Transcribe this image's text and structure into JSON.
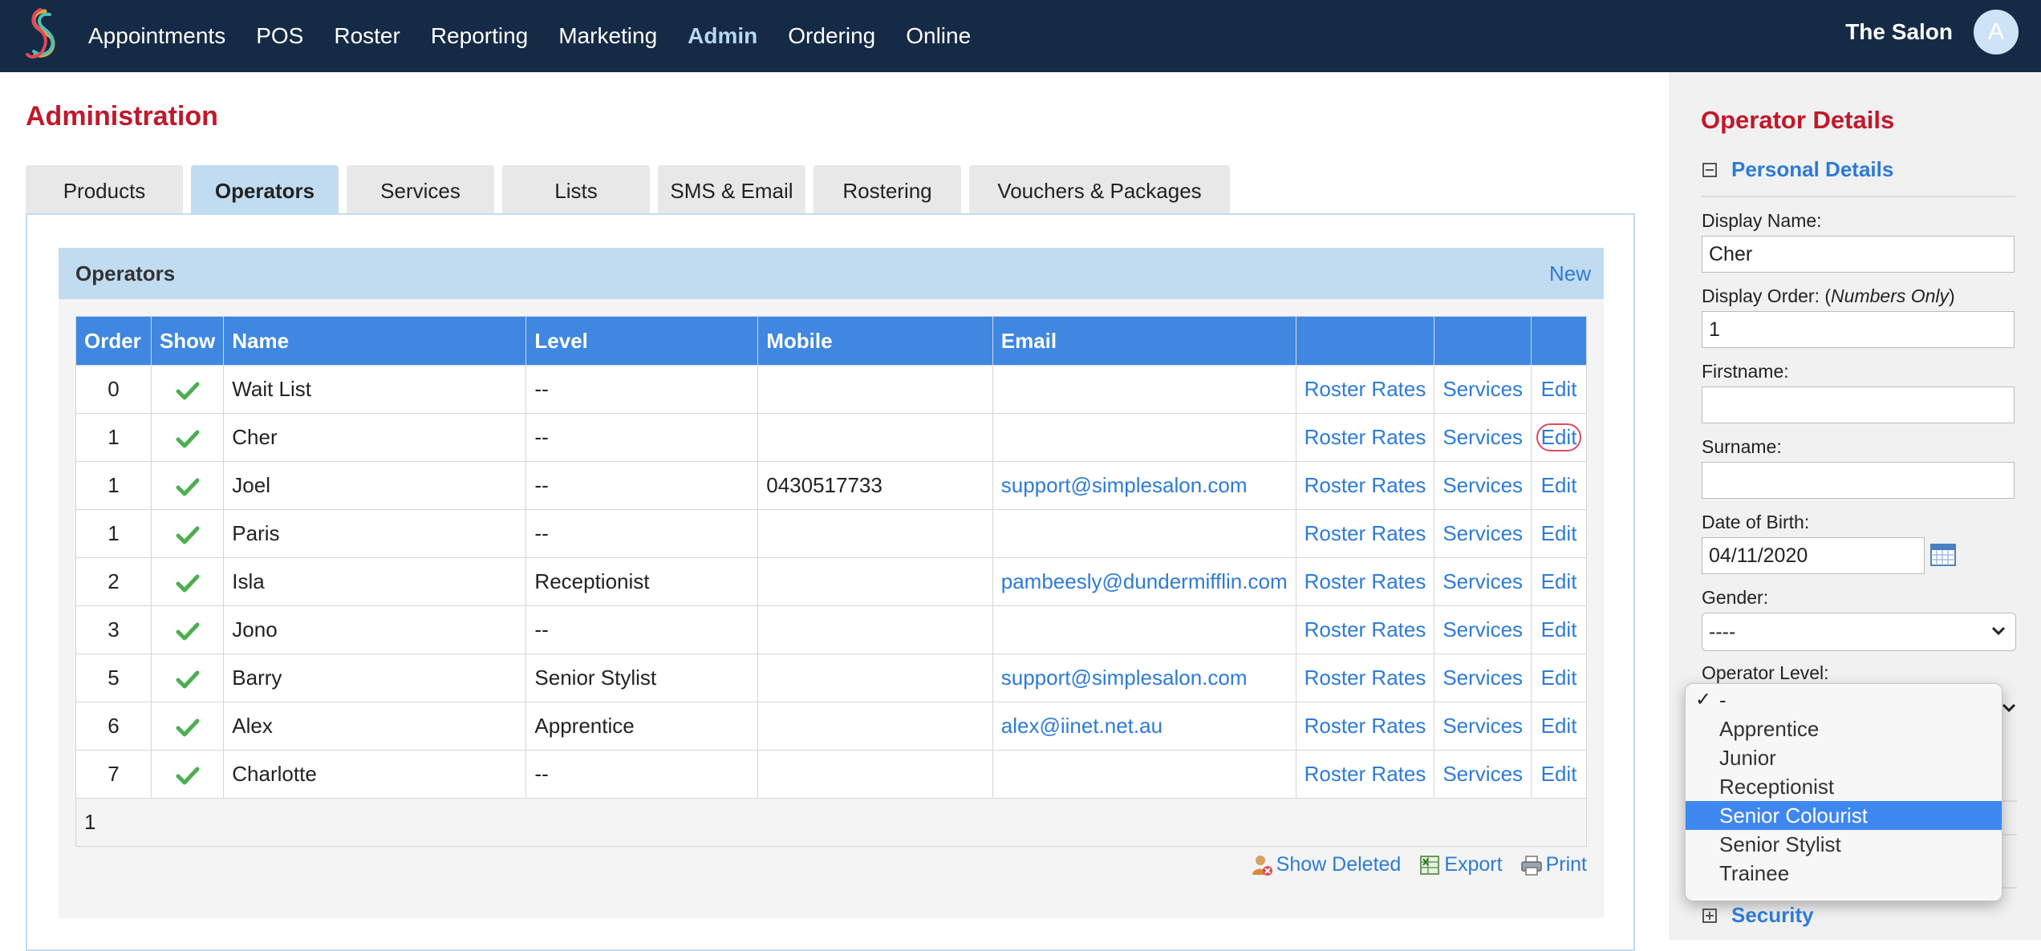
{
  "nav": {
    "items": [
      "Appointments",
      "POS",
      "Roster",
      "Reporting",
      "Marketing",
      "Admin",
      "Ordering",
      "Online"
    ],
    "active": "Admin",
    "salon_name": "The Salon",
    "avatar_letter": "A"
  },
  "page": {
    "title": "Administration",
    "tabs": [
      "Products",
      "Operators",
      "Services",
      "Lists",
      "SMS & Email",
      "Rostering",
      "Vouchers & Packages"
    ],
    "active_tab": "Operators"
  },
  "operators": {
    "section_title": "Operators",
    "new_label": "New",
    "columns": [
      "Order",
      "Show",
      "Name",
      "Level",
      "Mobile",
      "Email",
      "",
      "",
      ""
    ],
    "rows": [
      {
        "order": "0",
        "show": true,
        "name": "Wait List",
        "level": "--",
        "mobile": "",
        "email": "",
        "roster": "Roster Rates",
        "services": "Services",
        "edit": "Edit"
      },
      {
        "order": "1",
        "show": true,
        "name": "Cher",
        "level": "--",
        "mobile": "",
        "email": "",
        "roster": "Roster Rates",
        "services": "Services",
        "edit": "Edit"
      },
      {
        "order": "1",
        "show": true,
        "name": "Joel",
        "level": "--",
        "mobile": "0430517733",
        "email": "support@simplesalon.com",
        "roster": "Roster Rates",
        "services": "Services",
        "edit": "Edit"
      },
      {
        "order": "1",
        "show": true,
        "name": "Paris",
        "level": "--",
        "mobile": "",
        "email": "",
        "roster": "Roster Rates",
        "services": "Services",
        "edit": "Edit"
      },
      {
        "order": "2",
        "show": true,
        "name": "Isla",
        "level": "Receptionist",
        "mobile": "",
        "email": "pambeesly@dundermifflin.com",
        "roster": "Roster Rates",
        "services": "Services",
        "edit": "Edit"
      },
      {
        "order": "3",
        "show": true,
        "name": "Jono",
        "level": "--",
        "mobile": "",
        "email": "",
        "roster": "Roster Rates",
        "services": "Services",
        "edit": "Edit"
      },
      {
        "order": "5",
        "show": true,
        "name": "Barry",
        "level": "Senior Stylist",
        "mobile": "",
        "email": "support@simplesalon.com",
        "roster": "Roster Rates",
        "services": "Services",
        "edit": "Edit"
      },
      {
        "order": "6",
        "show": true,
        "name": "Alex",
        "level": "Apprentice",
        "mobile": "",
        "email": "alex@iinet.net.au",
        "roster": "Roster Rates",
        "services": "Services",
        "edit": "Edit"
      },
      {
        "order": "7",
        "show": true,
        "name": "Charlotte",
        "level": "--",
        "mobile": "",
        "email": "",
        "roster": "Roster Rates",
        "services": "Services",
        "edit": "Edit"
      }
    ],
    "highlighted_edit_row": 1,
    "pager": "1",
    "actions": {
      "show_deleted": "Show Deleted",
      "export": "Export",
      "print": "Print"
    }
  },
  "operator_details": {
    "title": "Operator Details",
    "personal_section": "Personal Details",
    "display_name_label": "Display Name:",
    "display_name": "Cher",
    "display_order_label": "Display Order: (",
    "display_order_hint": "Numbers Only",
    "display_order_close": ")",
    "display_order": "1",
    "firstname_label": "Firstname:",
    "firstname": "",
    "surname_label": "Surname:",
    "surname": "",
    "dob_label": "Date of Birth:",
    "dob": "04/11/2020",
    "gender_label": "Gender:",
    "gender": "----",
    "operator_level_label": "Operator Level:",
    "level_options": [
      "-",
      "Apprentice",
      "Junior",
      "Receptionist",
      "Senior Colourist",
      "Senior Stylist",
      "Trainee"
    ],
    "level_checked": "-",
    "level_highlighted": "Senior Colourist",
    "security_section": "Security"
  },
  "colors": {
    "nav_bg": "#152a45",
    "accent_red": "#c0182b",
    "link_blue": "#2d7bd6",
    "header_blue": "#3f87e0",
    "highlight": "#3f87f0"
  }
}
